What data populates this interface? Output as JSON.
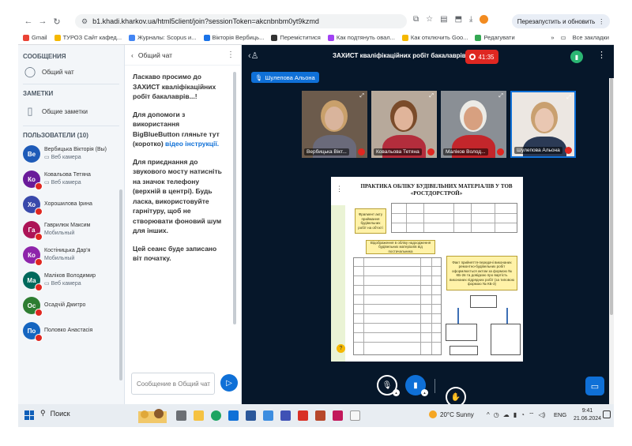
{
  "browser": {
    "url": "b1.khadi.kharkov.ua/html5client/join?sessionToken=akcnbnbm0yt9kzmd",
    "relaunch_label": "Перезапустить и обновить",
    "bookmarks": [
      {
        "label": "Gmail",
        "color": "#ea4335"
      },
      {
        "label": "ТУРОЗ Сайт кафед...",
        "color": "#f5b800"
      },
      {
        "label": "Журналы: Scopus и...",
        "color": "#4285f4"
      },
      {
        "label": "Вікторія Вербиць...",
        "color": "#1a73e8"
      },
      {
        "label": "Переміститися",
        "color": "#333333"
      },
      {
        "label": "Как подтянуть овал...",
        "color": "#a142f4"
      },
      {
        "label": "Как отключить Goo...",
        "color": "#f5b800"
      },
      {
        "label": "Редагувати",
        "color": "#34a853"
      }
    ],
    "all_bookmarks_label": "Все закладки"
  },
  "sidebar": {
    "messages_title": "СООБЩЕНИЯ",
    "public_chat_label": "Общий чат",
    "notes_title": "ЗАМЕТКИ",
    "shared_notes_label": "Общие заметки",
    "users_title": "ПОЛЬЗОВАТЕЛИ (10)",
    "users": [
      {
        "initials": "Ве",
        "name": "Вербицька Вікторія (Вы)",
        "sub": "Веб камера",
        "color": "#1e5bb8",
        "muted": false,
        "show_sub_icon": true
      },
      {
        "initials": "Ко",
        "name": "Ковальова Тетяна",
        "sub": "Веб камера",
        "color": "#6a1b9a",
        "muted": true,
        "show_sub_icon": true
      },
      {
        "initials": "Хо",
        "name": "Хорошилова Ірина",
        "sub": "",
        "color": "#3949ab",
        "muted": true,
        "show_sub_icon": false
      },
      {
        "initials": "Га",
        "name": "Гаврилюк Максим",
        "sub": "Мобильный",
        "color": "#ad1457",
        "muted": true,
        "show_sub_icon": false
      },
      {
        "initials": "Ко",
        "name": "Костіницька Дар'я",
        "sub": "Мобильный",
        "color": "#8e24aa",
        "muted": true,
        "show_sub_icon": false
      },
      {
        "initials": "Ма",
        "name": "Маліков Володимир",
        "sub": "Веб камера",
        "color": "#00695c",
        "muted": true,
        "show_sub_icon": true
      },
      {
        "initials": "Ос",
        "name": "Осадчій Дмитро",
        "sub": "",
        "color": "#2e7d32",
        "muted": true,
        "show_sub_icon": false
      },
      {
        "initials": "По",
        "name": "Половко Анастасія",
        "sub": "",
        "color": "#1565c0",
        "muted": true,
        "show_sub_icon": false
      }
    ]
  },
  "chat": {
    "header": "Общий чат",
    "welcome": "Ласкаво просимо до ЗАХИСТ кваліфікаційних робіт бакалаврів...!",
    "help_prefix": "Для допомоги з використання BigBlueButton гляньте тут (коротко)",
    "help_link": "відео інструкції.",
    "audio_text": "Для приєднання до звукового мосту натисніть на значок телефону (верхній в центрі). Будь ласка, використовуйте гарнітуру, щоб не створювати фоновий шум для інших.",
    "record_text": "Цей сеанс буде записано віт початку.",
    "input_placeholder": "Сообщение в Общий чат"
  },
  "meeting": {
    "title": "ЗАХИСТ кваліфікаційних робіт бакалаврів...",
    "timer": "41:35",
    "talking": "Шулепова Альона",
    "tiles": [
      {
        "name": "Вербицька Вікт...",
        "bg": "#6c5b4c",
        "skin": "#d9b49c",
        "hair": "#c9a06b",
        "shirt": "#6a6a7a"
      },
      {
        "name": "Ковальова Тетяна",
        "bg": "#b7a99b",
        "skin": "#e0b49a",
        "hair": "#7a4b2a",
        "shirt": "#b32d3c"
      },
      {
        "name": "Маліков Волод...",
        "bg": "#8a8f95",
        "skin": "#d7a080",
        "hair": "#ecebe6",
        "shirt": "#c3262b"
      },
      {
        "name": "Шулепова Альона",
        "bg": "#ece7e2",
        "skin": "#e9c7b2",
        "hair": "#c9a070",
        "shirt": "#2b3a55"
      }
    ]
  },
  "slide": {
    "title": "ПРАКТИКА ОБЛІКУ БУДІВЕЛЬНИХ МАТЕРІАЛІВ У ТОВ «РОСТДОРСТРОЙ»",
    "box1": "Фрагмент акту приймання будівельних робіт на об'єкті",
    "box2": "Відображення в обліку надходження будівельних матеріалів від постачальника",
    "box3": "Факт прийняття-передачі виконаних ремонтно-будівельних робіт оформлюється актом за формою № КБ-2в та довідкою про вартість виконаних підрядних робіт (за типовою формою № КБ-3)"
  },
  "taskbar": {
    "search_label": "Поиск",
    "weather": "20°C Sunny",
    "lang": "ENG",
    "time": "9:41",
    "date": "21.06.2024"
  }
}
